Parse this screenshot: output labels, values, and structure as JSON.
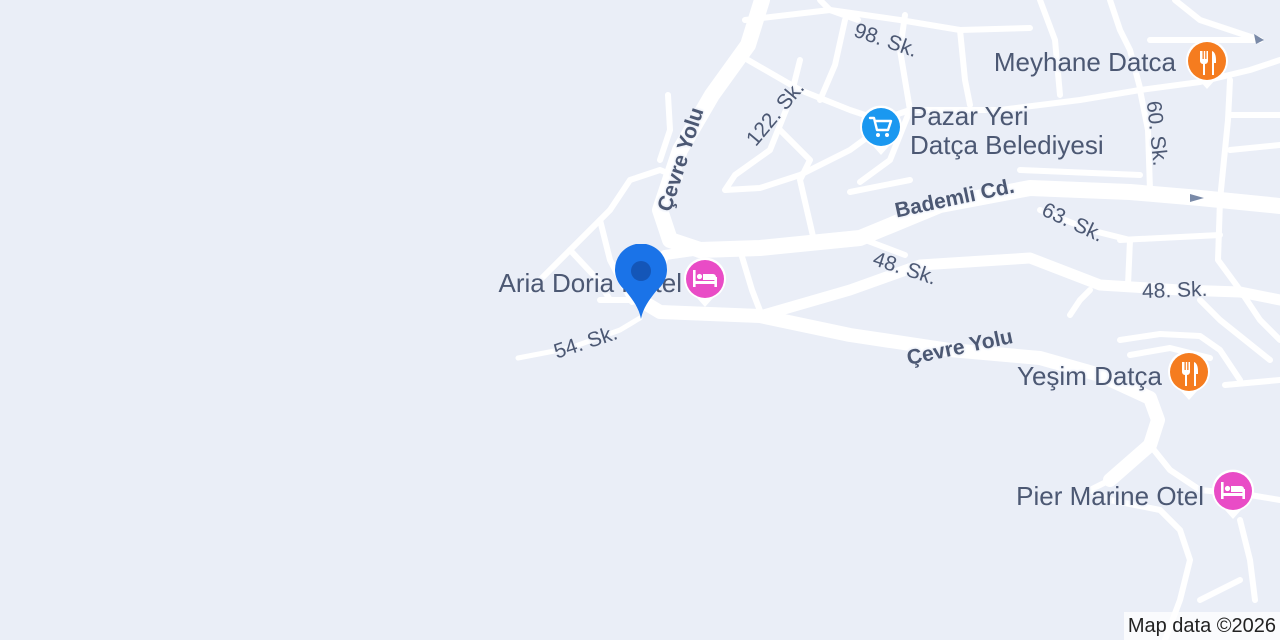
{
  "map": {
    "colors": {
      "background": "#eaeef7",
      "road": "#ffffff",
      "label": "#4c5873",
      "hotel_marker": "#e94cc6",
      "restaurant_marker": "#f57c1f",
      "shopping_marker": "#1a98f0",
      "location_pin": "#1a73e8"
    },
    "streets": {
      "cevre_yolu_north": "Çevre Yolu",
      "cevre_yolu_south": "Çevre Yolu",
      "sk_98": "98. Sk.",
      "sk_122": "122. Sk.",
      "sk_60": "60. Sk.",
      "bademli": "Bademli Cd.",
      "sk_63": "63. Sk.",
      "sk_48_west": "48. Sk.",
      "sk_48_east": "48. Sk.",
      "sk_54": "54. Sk."
    },
    "places": {
      "meyhane": {
        "name": "Meyhane Datca",
        "icon": "restaurant-icon"
      },
      "pazar": {
        "line1": "Pazar Yeri",
        "line2": "Datça Belediyesi",
        "icon": "shopping-cart-icon"
      },
      "aria": {
        "name": "Aria Doria Hotel",
        "icon": "hotel-bed-icon"
      },
      "yesim": {
        "name": "Yeşim Datça",
        "icon": "restaurant-icon"
      },
      "pier": {
        "name": "Pier Marine Otel",
        "icon": "hotel-bed-icon"
      }
    },
    "attribution": "Map data ©2026"
  }
}
